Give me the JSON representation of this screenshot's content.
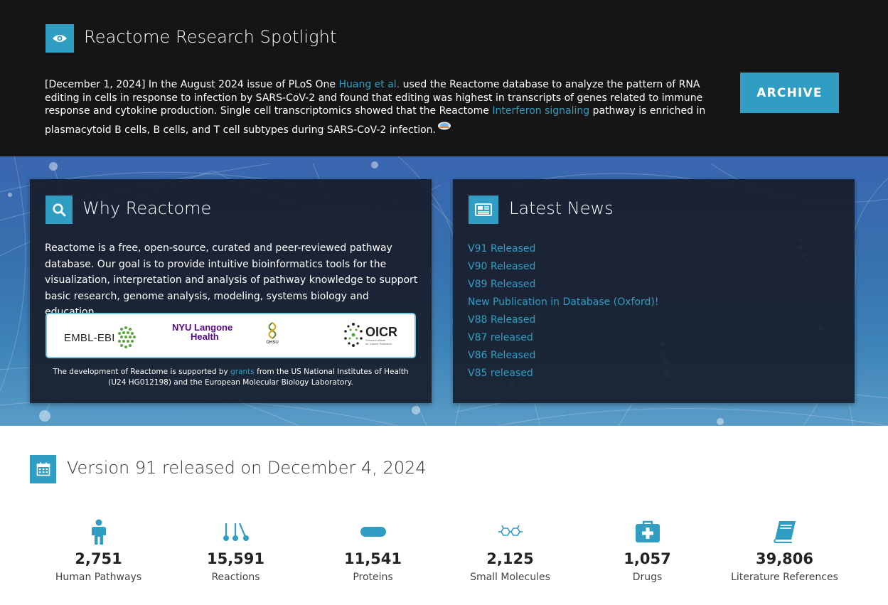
{
  "spotlight": {
    "title": "Reactome Research Spotlight",
    "text_1": "[December 1, 2024] In the August 2024 issue of PLoS One ",
    "link_1": "Huang et al.",
    "text_2": " used the Reactome database to analyze the pattern of RNA editing in cells in response to infection by SARS-CoV-2 and found that editing was highest in transcripts of genes related to immune response and cytokine production. Single cell transcriptomics showed that the Reactome ",
    "link_2": "Interferon signaling",
    "text_3": " pathway is enriched in",
    "text_4": "plasmacytoid B cells, B cells, and T cell subtypes during SARS-CoV-2 infection.",
    "archive_label": "ARCHIVE",
    "icon": "eye-icon"
  },
  "why": {
    "title": "Why Reactome",
    "text": "Reactome is a free, open-source, curated and peer-reviewed pathway database. Our goal is to provide intuitive bioinformatics tools for the visualization, interpretation and analysis of pathway knowledge to support basic research, genome analysis, modeling, systems biology and education.",
    "logos": {
      "embl": "EMBL-EBI",
      "nyu_1": "NYU Langone",
      "nyu_2": "Health",
      "ohsu": "OHSU",
      "oicr": "OICR",
      "oicr_small_1": "Ontario Institute",
      "oicr_small_2": "for Cancer Research"
    },
    "funding_1": "The development of Reactome is supported by ",
    "funding_link": "grants",
    "funding_2": " from the US National Institutes of Health (U24 HG012198) and the European Molecular Biology Laboratory.",
    "icon": "search-icon"
  },
  "news": {
    "title": "Latest News",
    "items": [
      "V91 Released",
      "V90 Released",
      "V89 Released",
      "New Publication in Database (Oxford)!",
      "V88 Released",
      "V87 released",
      "V86 Released",
      "V85 released"
    ],
    "icon": "newspaper-icon"
  },
  "release": {
    "title": "Version 91 released on December 4, 2024",
    "icon": "calendar-icon",
    "stats": [
      {
        "value": "2,751",
        "label": "Human Pathways",
        "icon": "human-figure-icon"
      },
      {
        "value": "15,591",
        "label": "Reactions",
        "icon": "reaction-icon"
      },
      {
        "value": "11,541",
        "label": "Proteins",
        "icon": "protein-icon"
      },
      {
        "value": "2,125",
        "label": "Small Molecules",
        "icon": "molecule-icon"
      },
      {
        "value": "1,057",
        "label": "Drugs",
        "icon": "medical-kit-icon"
      },
      {
        "value": "39,806",
        "label": "Literature References",
        "icon": "book-icon"
      }
    ]
  },
  "colors": {
    "accent": "#2f9ec2",
    "spotlight_bg": "#151515",
    "panel_bg": "#181e2c",
    "hero_blue": "#3a66b0"
  }
}
